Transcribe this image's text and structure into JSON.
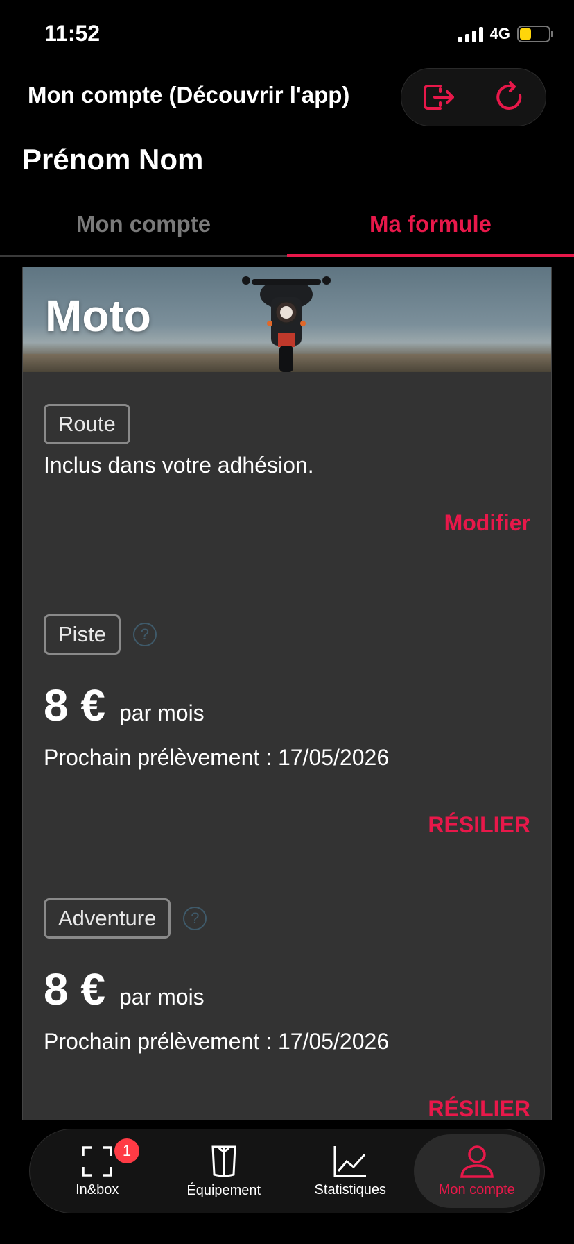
{
  "status_bar": {
    "time": "11:52",
    "network": "4G"
  },
  "header": {
    "title": "Mon compte (Découvrir l'app)",
    "user_name": "Prénom Nom",
    "accent": "#e8184a"
  },
  "tabs": [
    {
      "label": "Mon compte",
      "active": false
    },
    {
      "label": "Ma formule",
      "active": true
    }
  ],
  "card": {
    "banner_title": "Moto",
    "sections": [
      {
        "pill": "Route",
        "description": "Inclus dans votre adhésion.",
        "action": "Modifier"
      },
      {
        "pill": "Piste",
        "price": "8 €",
        "per": "par mois",
        "next_payment": "Prochain prélèvement : 17/05/2026",
        "action": "RÉSILIER"
      },
      {
        "pill": "Adventure",
        "price": "8 €",
        "per": "par mois",
        "next_payment": "Prochain prélèvement : 17/05/2026",
        "action": "RÉSILIER"
      }
    ]
  },
  "bottom_nav": [
    {
      "label": "In&box",
      "icon": "inbox-scan-icon",
      "badge": "1"
    },
    {
      "label": "Équipement",
      "icon": "equipment-icon"
    },
    {
      "label": "Statistiques",
      "icon": "stats-chart-icon"
    },
    {
      "label": "Mon compte",
      "icon": "user-icon",
      "active": true
    }
  ]
}
